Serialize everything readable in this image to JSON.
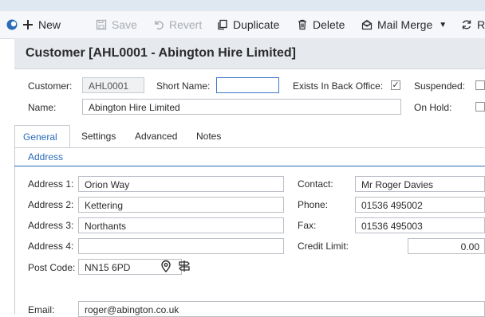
{
  "toolbar": {
    "new_label": "New",
    "save_label": "Save",
    "revert_label": "Revert",
    "duplicate_label": "Duplicate",
    "delete_label": "Delete",
    "mail_merge_label": "Mail Merge",
    "refresh_label": "R"
  },
  "header": {
    "title": "Customer [AHL0001 - Abington Hire Limited]"
  },
  "form": {
    "customer_label": "Customer:",
    "customer_value": "AHL0001",
    "short_name_label": "Short Name:",
    "short_name_value": "",
    "exists_label": "Exists In Back Office:",
    "exists_checked": "✓",
    "suspended_label": "Suspended:",
    "name_label": "Name:",
    "name_value": "Abington Hire Limited",
    "on_hold_label": "On Hold:"
  },
  "tabs": [
    {
      "label": "General"
    },
    {
      "label": "Settings"
    },
    {
      "label": "Advanced"
    },
    {
      "label": "Notes"
    }
  ],
  "section_title": "Address",
  "address": {
    "address1_label": "Address 1:",
    "address1_value": "Orion Way",
    "address2_label": "Address 2:",
    "address2_value": "Kettering",
    "address3_label": "Address 3:",
    "address3_value": "Northants",
    "address4_label": "Address 4:",
    "address4_value": "",
    "postcode_label": "Post Code:",
    "postcode_value": "NN15 6PD"
  },
  "contact": {
    "contact_label": "Contact:",
    "contact_value": "Mr Roger Davies",
    "phone_label": "Phone:",
    "phone_value": "01536 495002",
    "fax_label": "Fax:",
    "fax_value": "01536 495003",
    "credit_label": "Credit Limit:",
    "credit_value": "0.00"
  },
  "email": {
    "label": "Email:",
    "value": "roger@abington.co.uk"
  },
  "colors": {
    "accent": "#2b6cb8",
    "toolbar_bg": "#f5f7fa",
    "title_bg": "#e6e9ed"
  }
}
